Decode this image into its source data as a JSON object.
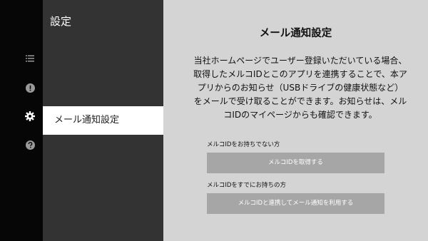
{
  "sidebar": {
    "icons": [
      "list-icon",
      "alert-icon",
      "gear-icon",
      "help-icon"
    ],
    "icon_color": "#9a9a9a",
    "active_icon_color": "#ffffff"
  },
  "panel": {
    "title": "設定",
    "items": [
      {
        "label": "メール通知設定",
        "selected": true
      }
    ]
  },
  "main": {
    "title": "メール通知設定",
    "description": "当社ホームページでユーザー登録いただいている場合、取得したメルコIDとこのアプリを連携することで、本アプリからのお知らせ（USBドライブの健康状態など）をメールで受け取ることができます。お知らせは、メルコIDのマイページからも確認できます。",
    "sections": [
      {
        "label": "メルコIDをお持ちでない方",
        "button": "メルコIDを取得する"
      },
      {
        "label": "メルコIDをすでにお持ちの方",
        "button": "メルコIDと連携してメール通知を利用する"
      }
    ]
  },
  "colors": {
    "rail_bg": "#060606",
    "panel_bg": "#333333",
    "content_bg": "#d4d4d4",
    "button_bg": "#a6a6a6",
    "selected_item_bg": "#ffffff"
  }
}
